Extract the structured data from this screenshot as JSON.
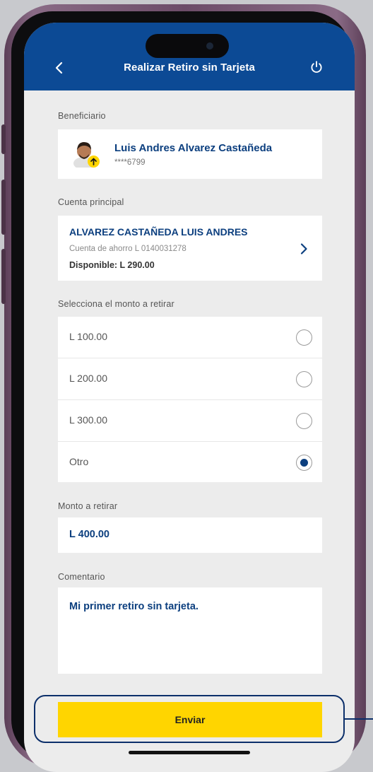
{
  "header": {
    "title": "Realizar Retiro sin Tarjeta",
    "back_icon": "chevron-left-icon",
    "power_icon": "power-icon"
  },
  "beneficiary": {
    "section_label": "Beneficiario",
    "name": "Luis Andres Alvarez Castañeda",
    "account_masked": "****6799",
    "badge_icon": "arrow-up-icon"
  },
  "account": {
    "section_label": "Cuenta principal",
    "holder": "ALVAREZ CASTAÑEDA LUIS ANDRES",
    "type_number": "Cuenta de ahorro L 0140031278",
    "available": "Disponible: L 290.00",
    "chevron_icon": "chevron-right-icon"
  },
  "amount_select": {
    "section_label": "Selecciona el monto a retirar",
    "options": [
      {
        "label": "L 100.00",
        "selected": false
      },
      {
        "label": "L 200.00",
        "selected": false
      },
      {
        "label": "L 300.00",
        "selected": false
      },
      {
        "label": "Otro",
        "selected": true
      }
    ]
  },
  "amount_input": {
    "section_label": "Monto a retirar",
    "value": "L 400.00"
  },
  "comment": {
    "section_label": "Comentario",
    "value": "Mi primer retiro sin tarjeta."
  },
  "submit": {
    "label": "Enviar"
  },
  "colors": {
    "header": "#0c4a95",
    "accent_text": "#0c3f7f",
    "button": "#ffd500",
    "highlight_ring": "#0c2f6a",
    "badge": "#ffd500"
  }
}
